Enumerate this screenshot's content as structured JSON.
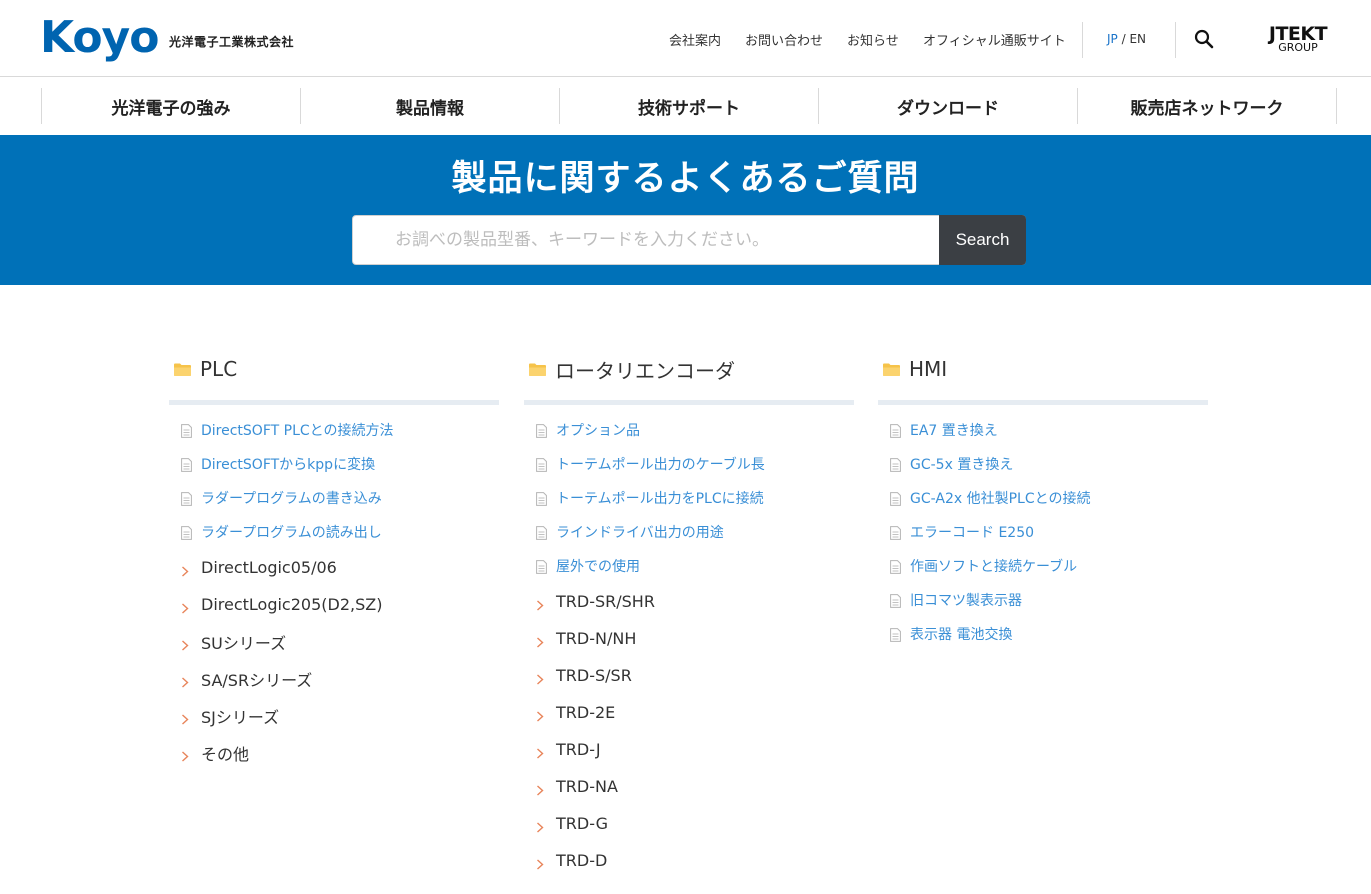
{
  "header": {
    "logo_text": "Koyo",
    "company_name": "光洋電子工業株式会社",
    "utility_links": [
      "会社案内",
      "お問い合わせ",
      "お知らせ",
      "オフィシャル通販サイト"
    ],
    "lang_jp": "JP",
    "lang_sep": " / ",
    "lang_en": "EN",
    "group_logo_top": "JTEKT",
    "group_logo_bottom": "GROUP"
  },
  "nav": {
    "items": [
      "光洋電子の強み",
      "製品情報",
      "技術サポート",
      "ダウンロード",
      "販売店ネットワーク"
    ]
  },
  "hero": {
    "title": "製品に関するよくあるご質問",
    "search_placeholder": "お調べの製品型番、キーワードを入力ください。",
    "search_button": "Search"
  },
  "columns": [
    {
      "title": "PLC",
      "faqs": [
        "DirectSOFT PLCとの接続方法",
        "DirectSOFTからkppに変換",
        "ラダープログラムの書き込み",
        "ラダープログラムの読み出し"
      ],
      "categories": [
        "DirectLogic05/06",
        "DirectLogic205(D2,SZ)",
        "SUシリーズ",
        "SA/SRシリーズ",
        "SJシリーズ",
        "その他"
      ]
    },
    {
      "title": "ロータリエンコーダ",
      "faqs": [
        "オプション品",
        "トーテムポール出力のケーブル長",
        "トーテムポール出力をPLCに接続",
        "ラインドライバ出力の用途",
        "屋外での使用"
      ],
      "categories": [
        "TRD-SR/SHR",
        "TRD-N/NH",
        "TRD-S/SR",
        "TRD-2E",
        "TRD-J",
        "TRD-NA",
        "TRD-G",
        "TRD-D"
      ]
    },
    {
      "title": "HMI",
      "faqs": [
        "EA7 置き換え",
        "GC-5x 置き換え",
        "GC-A2x 他社製PLCとの接続",
        "エラーコード E250",
        "作画ソフトと接続ケーブル",
        "旧コマツ製表示器",
        "表示器 電池交換"
      ],
      "categories": []
    }
  ],
  "colors": {
    "brand_blue": "#0064b0",
    "hero_blue": "#0071b8",
    "link_blue": "#3a8fd6",
    "folder_yellow": "#f6c34a",
    "chevron_orange": "#e8845a",
    "search_button_bg": "#3b3f44"
  },
  "icons": {
    "search": "search-icon",
    "folder": "folder-icon",
    "document": "document-icon",
    "chevron": "chevron-right-icon"
  }
}
